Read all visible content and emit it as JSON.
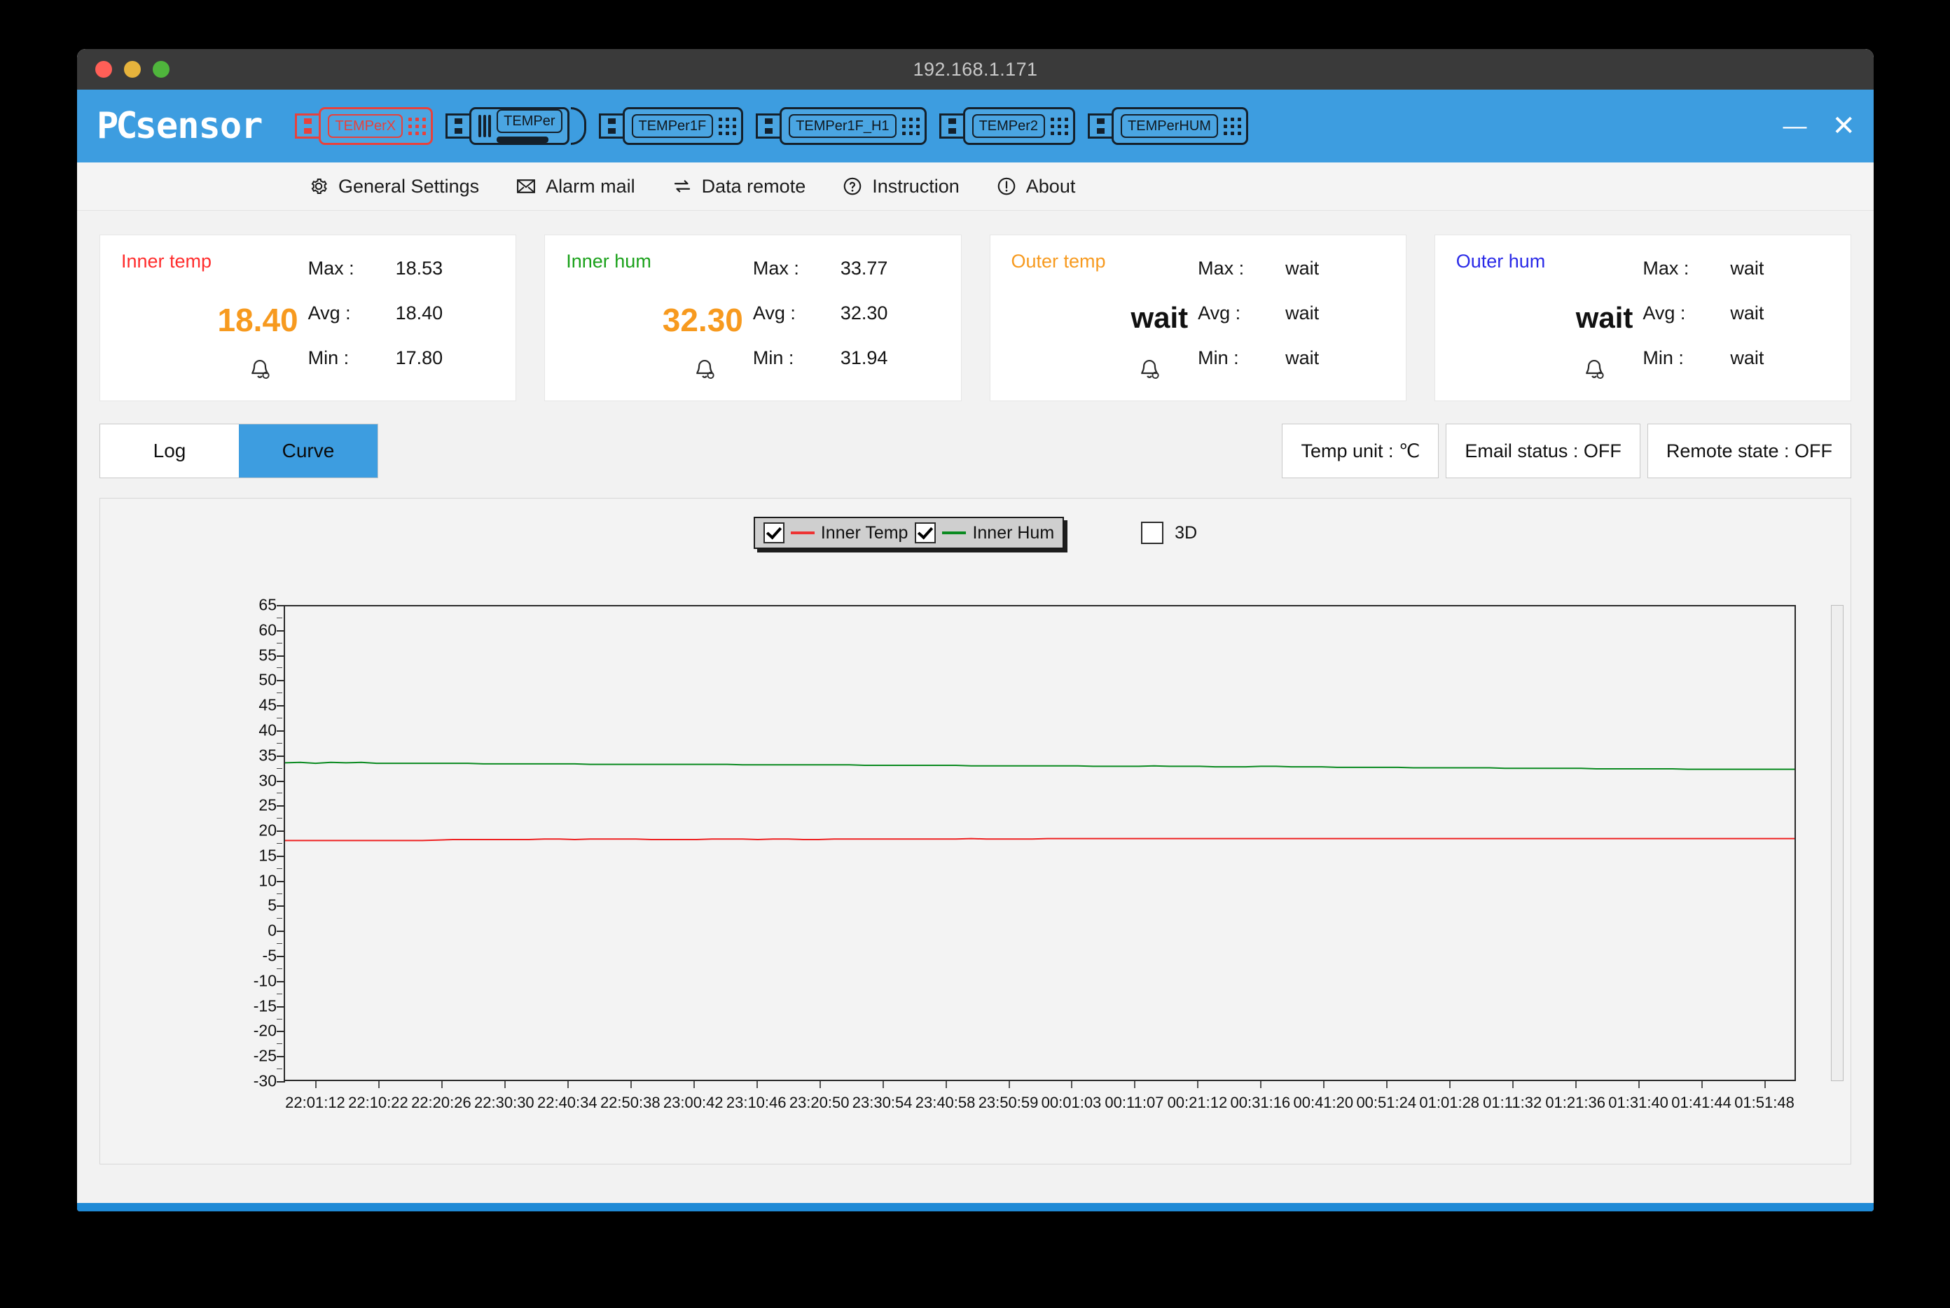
{
  "window": {
    "title": "192.168.1.171",
    "traffic_lights": [
      "close",
      "minimize",
      "zoom"
    ],
    "minimize_label": "—",
    "close_label": "✕"
  },
  "header": {
    "logo_pc": "PC",
    "logo_sensor": "sensor",
    "devices": [
      {
        "label": "TEMPerX",
        "selected": true
      },
      {
        "label": "TEMPer",
        "selected": false
      },
      {
        "label": "TEMPer1F",
        "selected": false
      },
      {
        "label": "TEMPer1F_H1",
        "selected": false
      },
      {
        "label": "TEMPer2",
        "selected": false
      },
      {
        "label": "TEMPerHUM",
        "selected": false
      }
    ]
  },
  "menu": {
    "items": [
      {
        "label": "General Settings",
        "icon": "gear-icon"
      },
      {
        "label": "Alarm mail",
        "icon": "envelope-icon"
      },
      {
        "label": "Data remote",
        "icon": "exchange-arrows-icon"
      },
      {
        "label": "Instruction",
        "icon": "question-circle-icon"
      },
      {
        "label": "About",
        "icon": "exclamation-circle-icon"
      }
    ]
  },
  "cards": [
    {
      "title": "Inner temp",
      "title_color": "#ff2d2d",
      "value": "18.40",
      "value_is_wait": false,
      "max_label": "Max :",
      "max": "18.53",
      "avg_label": "Avg :",
      "avg": "18.40",
      "min_label": "Min :",
      "min": "17.80"
    },
    {
      "title": "Inner hum",
      "title_color": "#1aa11a",
      "value": "32.30",
      "value_is_wait": false,
      "max_label": "Max :",
      "max": "33.77",
      "avg_label": "Avg :",
      "avg": "32.30",
      "min_label": "Min :",
      "min": "31.94"
    },
    {
      "title": "Outer temp",
      "title_color": "#f79a1f",
      "value": "wait",
      "value_is_wait": true,
      "max_label": "Max :",
      "max": "wait",
      "avg_label": "Avg :",
      "avg": "wait",
      "min_label": "Min :",
      "min": "wait"
    },
    {
      "title": "Outer hum",
      "title_color": "#2a2ae8",
      "value": "wait",
      "value_is_wait": true,
      "max_label": "Max :",
      "max": "wait",
      "avg_label": "Avg :",
      "avg": "wait",
      "min_label": "Min :",
      "min": "wait"
    }
  ],
  "tabs": [
    {
      "label": "Log",
      "active": false
    },
    {
      "label": "Curve",
      "active": true
    }
  ],
  "status_buttons": [
    {
      "label": "Temp unit : ℃"
    },
    {
      "label": "Email status : OFF"
    },
    {
      "label": "Remote state : OFF"
    }
  ],
  "chart_controls": {
    "threeD_label": "3D",
    "threeD_checked": false
  },
  "chart_data": {
    "type": "line",
    "title": "",
    "xlabel": "",
    "ylabel": "",
    "grid": false,
    "legend_position": "top-center",
    "ylim": [
      -30,
      65
    ],
    "yticks": [
      65,
      60,
      55,
      50,
      45,
      40,
      35,
      30,
      25,
      20,
      15,
      10,
      5,
      0,
      -5,
      -10,
      -15,
      -20,
      -25,
      -30
    ],
    "xticklabels": [
      "22:01:12",
      "22:10:22",
      "22:20:26",
      "22:30:30",
      "22:40:34",
      "22:50:38",
      "23:00:42",
      "23:10:46",
      "23:20:50",
      "23:30:54",
      "23:40:58",
      "23:50:59",
      "00:01:03",
      "00:11:07",
      "00:21:12",
      "00:31:16",
      "00:41:20",
      "00:51:24",
      "01:01:28",
      "01:11:32",
      "01:21:36",
      "01:31:40",
      "01:41:44",
      "01:51:48"
    ],
    "series": [
      {
        "name": "Inner Temp",
        "color": "#ee2222",
        "checked": true,
        "values": [
          18.0,
          18.0,
          18.0,
          18.0,
          18.0,
          18.0,
          18.0,
          18.0,
          18.0,
          18.0,
          18.1,
          18.2,
          18.2,
          18.2,
          18.2,
          18.2,
          18.2,
          18.3,
          18.3,
          18.2,
          18.3,
          18.3,
          18.3,
          18.3,
          18.2,
          18.2,
          18.2,
          18.2,
          18.3,
          18.3,
          18.3,
          18.2,
          18.3,
          18.3,
          18.2,
          18.2,
          18.3,
          18.3,
          18.3,
          18.3,
          18.3,
          18.3,
          18.3,
          18.3,
          18.3,
          18.4,
          18.3,
          18.3,
          18.3,
          18.3,
          18.4,
          18.4,
          18.4,
          18.4,
          18.4,
          18.4,
          18.4,
          18.4,
          18.4,
          18.4,
          18.4,
          18.4,
          18.4,
          18.4,
          18.4,
          18.4,
          18.4,
          18.4,
          18.4,
          18.4,
          18.4,
          18.4,
          18.4,
          18.4,
          18.4,
          18.4,
          18.4,
          18.4,
          18.4,
          18.4,
          18.4,
          18.4,
          18.4,
          18.4,
          18.4,
          18.4,
          18.4,
          18.4,
          18.4,
          18.4,
          18.4,
          18.4,
          18.4,
          18.4,
          18.4,
          18.4,
          18.4,
          18.4,
          18.4,
          18.4
        ]
      },
      {
        "name": "Inner Hum",
        "color": "#0a8a20",
        "checked": true,
        "values": [
          33.6,
          33.7,
          33.5,
          33.7,
          33.6,
          33.7,
          33.5,
          33.5,
          33.5,
          33.5,
          33.5,
          33.5,
          33.5,
          33.4,
          33.4,
          33.4,
          33.4,
          33.4,
          33.4,
          33.4,
          33.3,
          33.3,
          33.3,
          33.3,
          33.3,
          33.3,
          33.3,
          33.3,
          33.3,
          33.3,
          33.2,
          33.2,
          33.2,
          33.2,
          33.2,
          33.2,
          33.2,
          33.2,
          33.1,
          33.1,
          33.1,
          33.1,
          33.1,
          33.1,
          33.1,
          33.0,
          33.0,
          33.0,
          33.0,
          33.0,
          33.0,
          33.0,
          33.0,
          32.9,
          32.9,
          32.9,
          32.9,
          33.0,
          32.9,
          32.9,
          32.9,
          32.8,
          32.8,
          32.8,
          32.9,
          32.9,
          32.8,
          32.8,
          32.8,
          32.7,
          32.7,
          32.7,
          32.7,
          32.7,
          32.6,
          32.6,
          32.6,
          32.6,
          32.6,
          32.6,
          32.5,
          32.5,
          32.5,
          32.5,
          32.5,
          32.5,
          32.4,
          32.4,
          32.4,
          32.4,
          32.4,
          32.4,
          32.3,
          32.3,
          32.3,
          32.3,
          32.3,
          32.3,
          32.3,
          32.3
        ]
      }
    ]
  }
}
